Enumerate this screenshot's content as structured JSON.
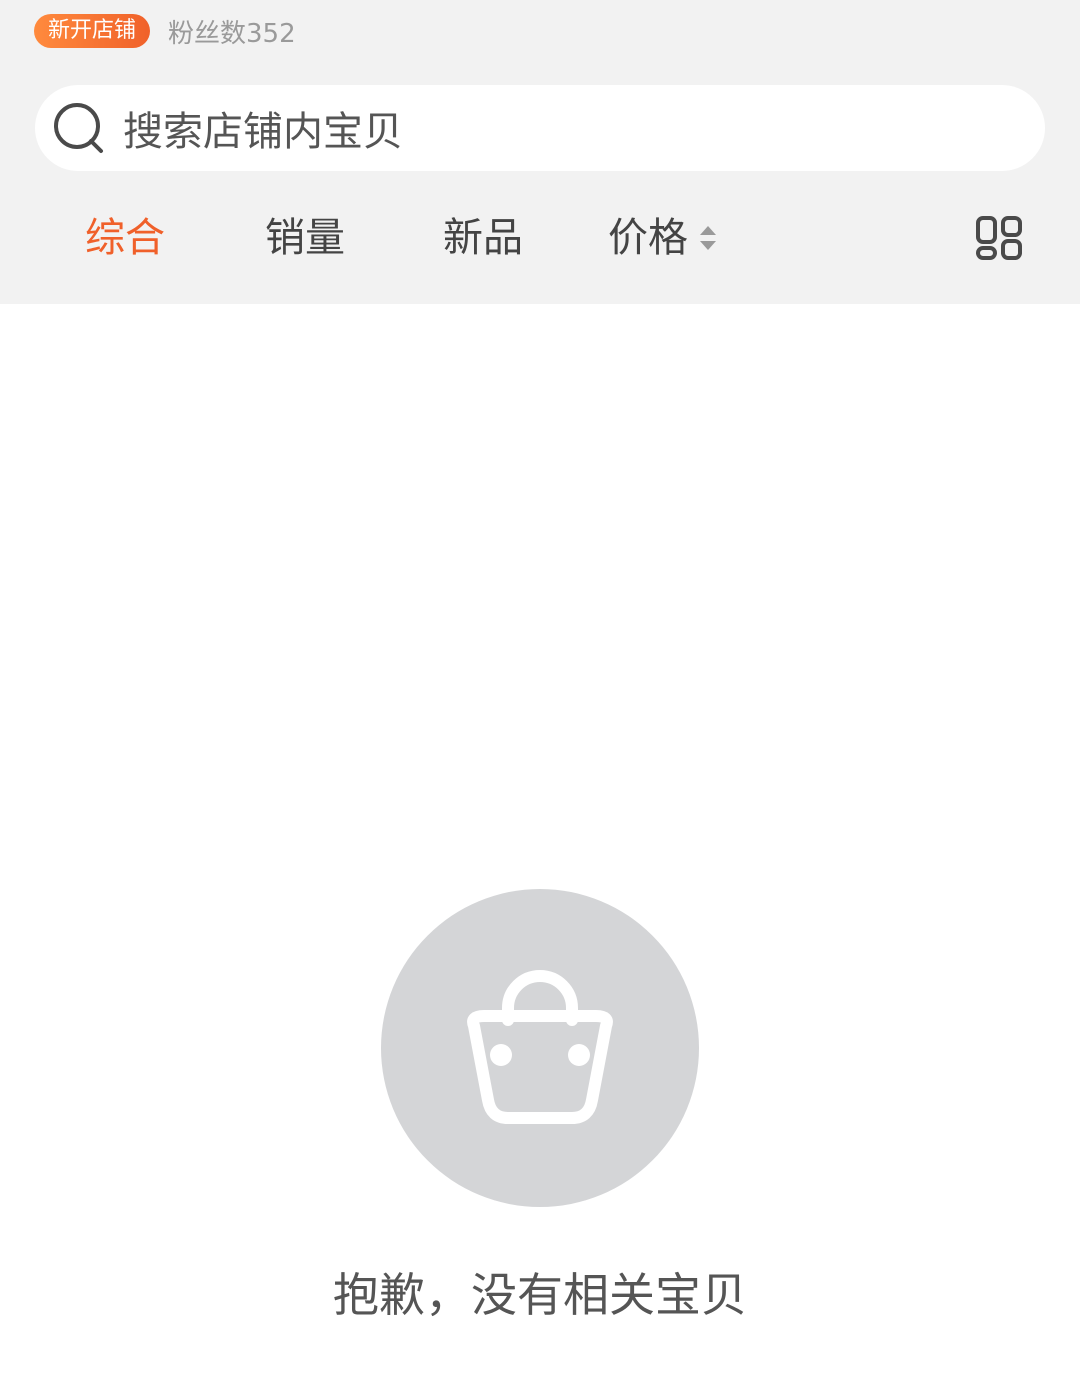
{
  "shop": {
    "badge_label": "新开店铺",
    "fans_label": "粉丝数352"
  },
  "search": {
    "icon": "search-icon",
    "placeholder": "搜索店铺内宝贝"
  },
  "sort_tabs": [
    {
      "label": "综合",
      "active": true
    },
    {
      "label": "销量",
      "active": false
    },
    {
      "label": "新品",
      "active": false
    },
    {
      "label": "价格",
      "active": false,
      "icon": "sort-arrows-icon"
    }
  ],
  "view_toggle": {
    "icon": "grid-view-icon"
  },
  "empty_state": {
    "icon": "shopping-bag-icon",
    "message": "抱歉，没有相关宝贝"
  },
  "colors": {
    "accent": "#f0602a",
    "header_bg": "#f2f2f2",
    "empty_circle": "#d4d5d7"
  }
}
